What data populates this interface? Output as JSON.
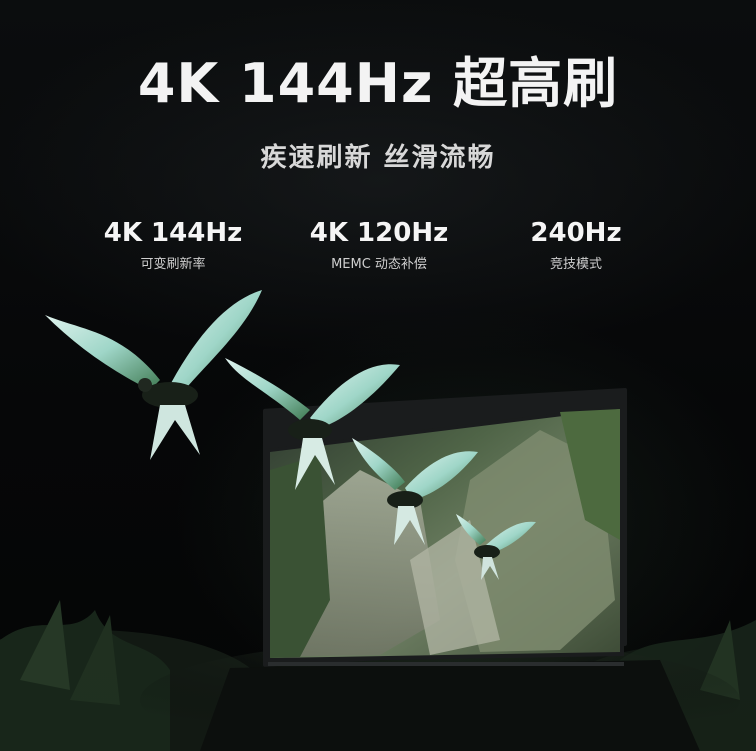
{
  "headline": "4K 144Hz 超高刷",
  "subheadline": "疾速刷新 丝滑流畅",
  "features": [
    {
      "value": "4K 144Hz",
      "caption": "可变刷新率"
    },
    {
      "value": "4K 120Hz",
      "caption": "MEMC 动态补偿"
    },
    {
      "value": "240Hz",
      "caption": "竞技模式"
    }
  ],
  "colors": {
    "background": "#050607",
    "text": "#f3f3f3",
    "subtext": "#d8d8d8",
    "tv_bezel": "#1a1c1d"
  },
  "icons": [
    "bird-icon",
    "tv-icon"
  ]
}
